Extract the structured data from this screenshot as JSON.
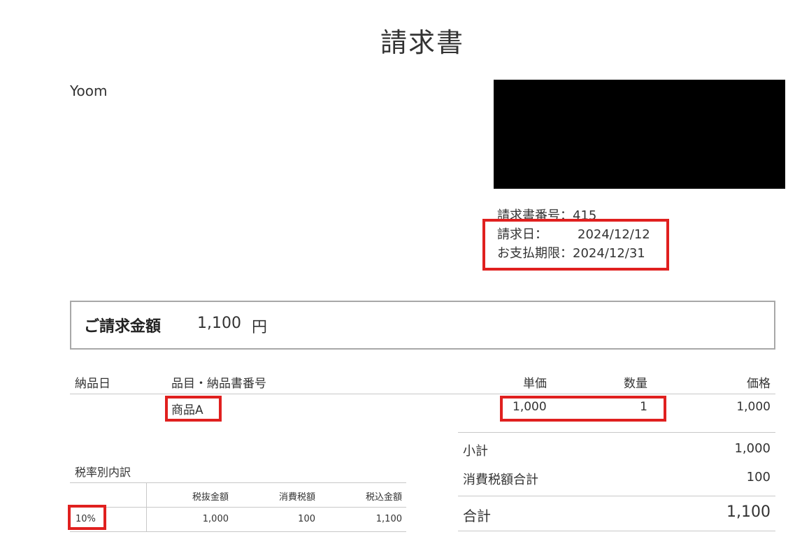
{
  "title": "請求書",
  "company": "Yoom",
  "invoice": {
    "number_label": "請求書番号：",
    "number": "415",
    "date_label": "請求日：",
    "date": "2024/12/12",
    "due_label": "お支払期限：",
    "due": "2024/12/31"
  },
  "amount": {
    "label": "ご請求金額",
    "value": "1,100",
    "unit": "円"
  },
  "items": {
    "headers": {
      "delivery_date": "納品日",
      "item": "品目・納品書番号",
      "unit_price": "単価",
      "quantity": "数量",
      "price": "価格"
    },
    "rows": [
      {
        "delivery_date": "",
        "item": "商品A",
        "unit_price": "1,000",
        "quantity": "1",
        "price": "1,000"
      }
    ]
  },
  "summary": {
    "subtotal_label": "小計",
    "subtotal": "1,000",
    "tax_label": "消費税額合計",
    "tax": "100",
    "total_label": "合計",
    "total": "1,100"
  },
  "tax_breakdown": {
    "title": "税率別内訳",
    "headers": {
      "rate": "",
      "excl": "税抜金額",
      "tax": "消費税額",
      "incl": "税込金額"
    },
    "rows": [
      {
        "rate": "10%",
        "excl": "1,000",
        "tax": "100",
        "incl": "1,100"
      }
    ]
  },
  "colors": {
    "highlight": "#e0201f",
    "redaction": "#000000",
    "border": "#a8a8a8"
  }
}
